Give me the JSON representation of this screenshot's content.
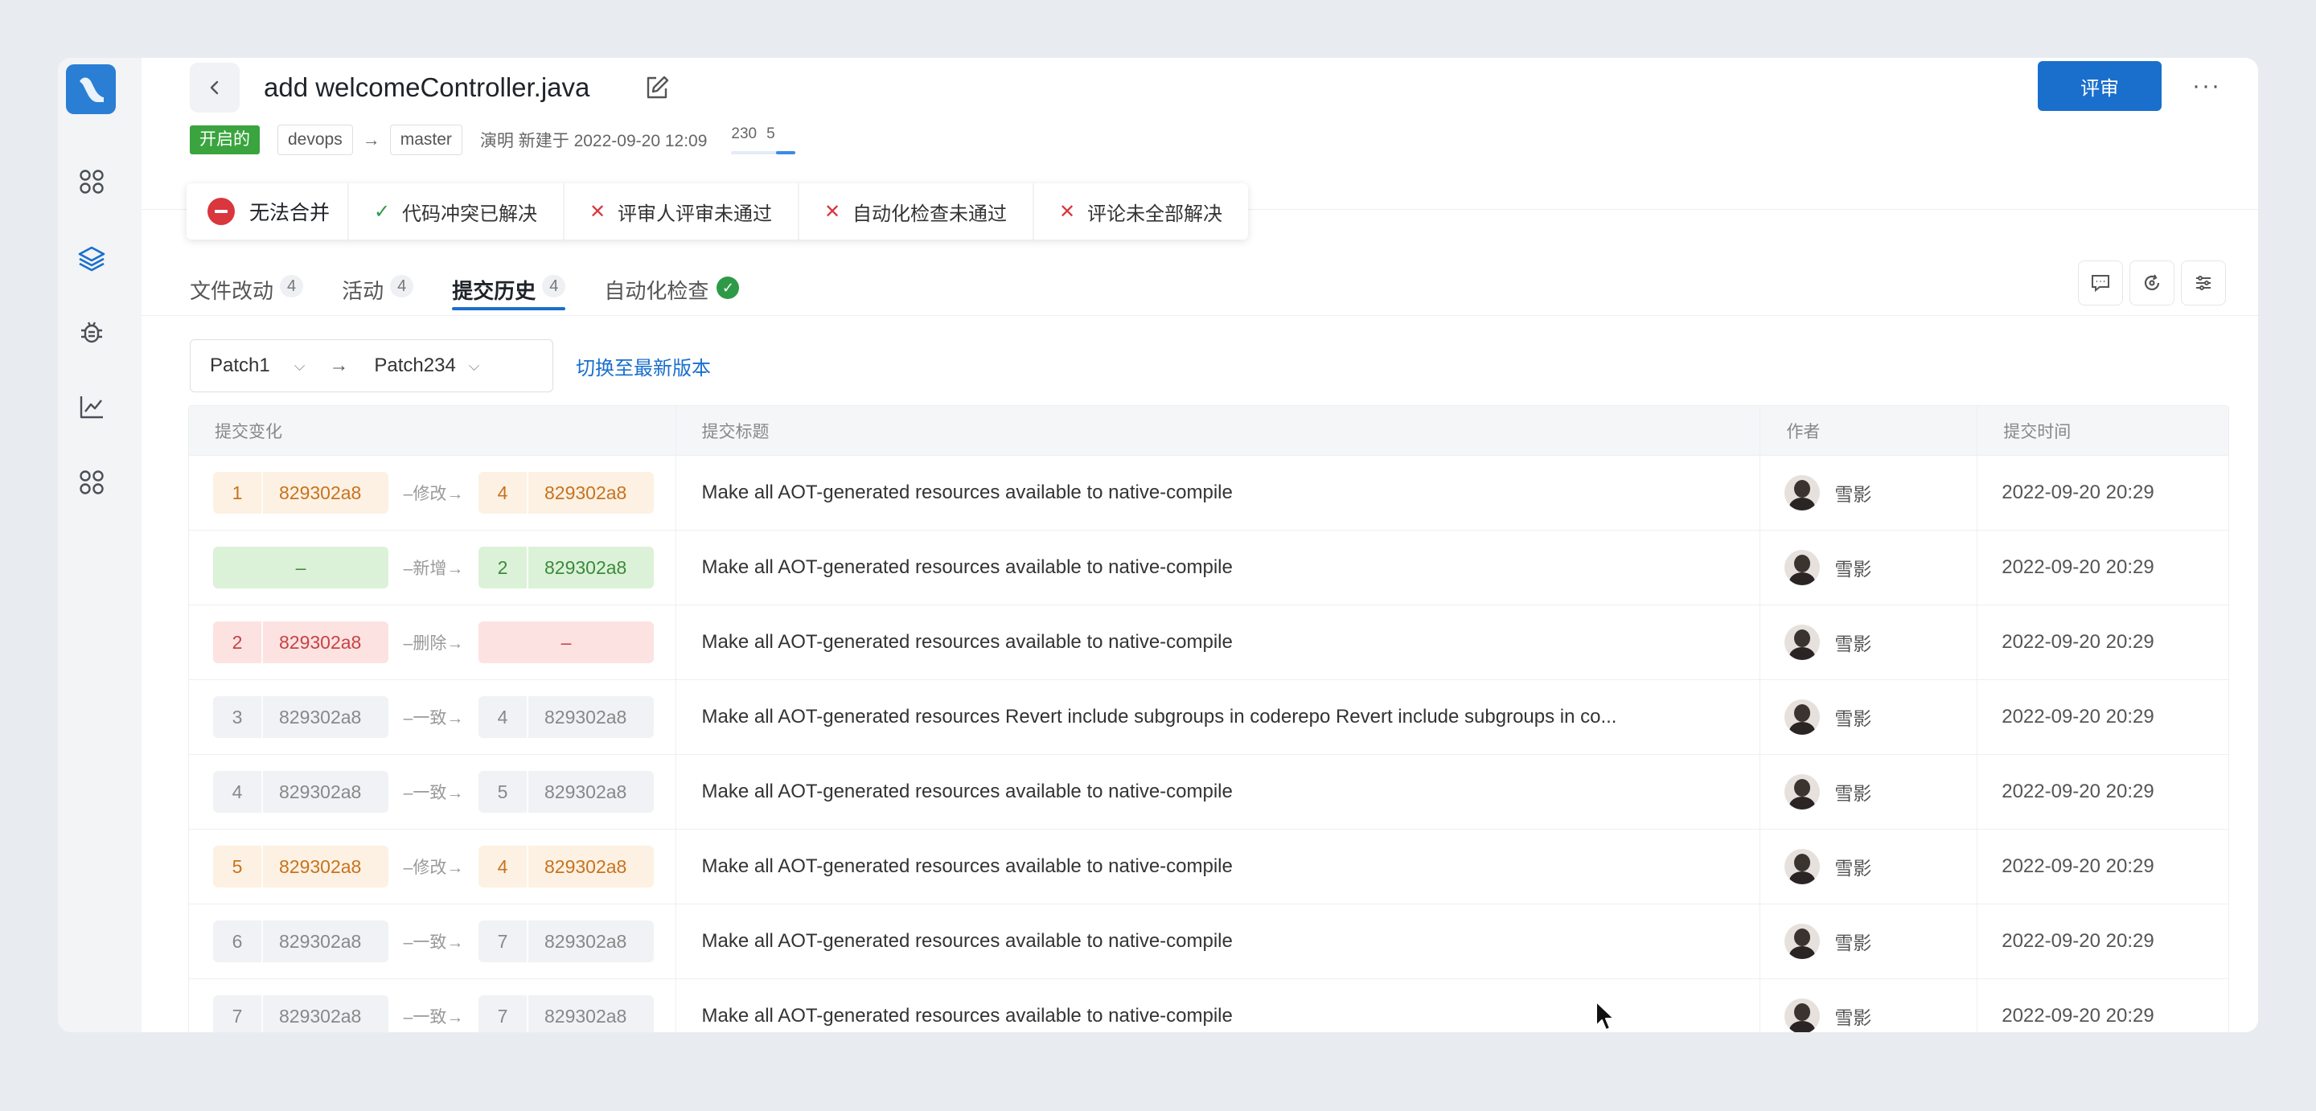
{
  "header": {
    "title": "add welcomeController.java",
    "review_label": "评审",
    "more_label": "···"
  },
  "meta": {
    "status": "开启的",
    "source_branch": "devops",
    "target_branch": "master",
    "creator": "演明 新建于 2022-09-20 12:09",
    "additions": "230",
    "deletions": "5"
  },
  "merge": {
    "status": "无法合并",
    "checks": [
      {
        "label": "代码冲突已解决",
        "ok": true
      },
      {
        "label": "评审人评审未通过",
        "ok": false
      },
      {
        "label": "自动化检查未通过",
        "ok": false
      },
      {
        "label": "评论未全部解决",
        "ok": false
      }
    ]
  },
  "tabs": [
    {
      "label": "文件改动",
      "count": "4"
    },
    {
      "label": "活动",
      "count": "4"
    },
    {
      "label": "提交历史",
      "count": "4",
      "active": true
    },
    {
      "label": "自动化检查"
    }
  ],
  "patch": {
    "from": "Patch1",
    "to": "Patch234",
    "switch_link": "切换至最新版本"
  },
  "table": {
    "headers": [
      "提交变化",
      "提交标题",
      "作者",
      "提交时间"
    ],
    "rows": [
      {
        "left_num": "1",
        "left_hash": "829302a8",
        "left_color": "orange",
        "change": "修改",
        "right_num": "4",
        "right_hash": "829302a8",
        "right_color": "orange",
        "title": "Make all AOT-generated resources available to native-compile",
        "author": "雪影",
        "time": "2022-09-20 20:29"
      },
      {
        "left_num": "",
        "left_hash": "–",
        "left_color": "green",
        "change": "新增",
        "right_num": "2",
        "right_hash": "829302a8",
        "right_color": "green",
        "title": "Make all AOT-generated resources available to native-compile",
        "author": "雪影",
        "time": "2022-09-20 20:29"
      },
      {
        "left_num": "2",
        "left_hash": "829302a8",
        "left_color": "red",
        "change": "删除",
        "right_num": "",
        "right_hash": "–",
        "right_color": "red",
        "title": "Make all AOT-generated resources available to native-compile",
        "author": "雪影",
        "time": "2022-09-20 20:29"
      },
      {
        "left_num": "3",
        "left_hash": "829302a8",
        "left_color": "gray",
        "change": "一致",
        "right_num": "4",
        "right_hash": "829302a8",
        "right_color": "gray",
        "title": "Make all AOT-generated resources Revert include subgroups in coderepo Revert include subgroups in co...",
        "author": "雪影",
        "time": "2022-09-20 20:29"
      },
      {
        "left_num": "4",
        "left_hash": "829302a8",
        "left_color": "gray",
        "change": "一致",
        "right_num": "5",
        "right_hash": "829302a8",
        "right_color": "gray",
        "title": "Make all AOT-generated resources available to native-compile",
        "author": "雪影",
        "time": "2022-09-20 20:29"
      },
      {
        "left_num": "5",
        "left_hash": "829302a8",
        "left_color": "orange",
        "change": "修改",
        "right_num": "4",
        "right_hash": "829302a8",
        "right_color": "orange",
        "title": "Make all AOT-generated resources available to native-compile",
        "author": "雪影",
        "time": "2022-09-20 20:29"
      },
      {
        "left_num": "6",
        "left_hash": "829302a8",
        "left_color": "gray",
        "change": "一致",
        "right_num": "7",
        "right_hash": "829302a8",
        "right_color": "gray",
        "title": "Make all AOT-generated resources available to native-compile",
        "author": "雪影",
        "time": "2022-09-20 20:29"
      },
      {
        "left_num": "7",
        "left_hash": "829302a8",
        "left_color": "gray",
        "change": "一致",
        "right_num": "7",
        "right_hash": "829302a8",
        "right_color": "gray",
        "title": "Make all AOT-generated resources available to native-compile",
        "author": "雪影",
        "time": "2022-09-20 20:29"
      }
    ]
  },
  "sidebar": {
    "icons": [
      "apps-icon",
      "layers-icon",
      "bug-icon",
      "chart-icon",
      "apps-icon"
    ]
  },
  "colors": {
    "accent": "#1a6fcd",
    "open": "#3aa43e",
    "error": "#d9363e"
  }
}
